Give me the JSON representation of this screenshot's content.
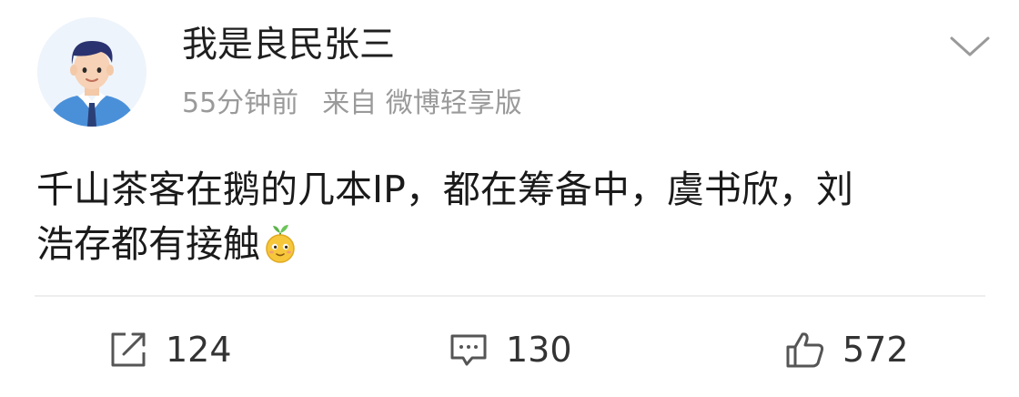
{
  "post": {
    "username": "我是良民张三",
    "time": "55分钟前",
    "source": "来自 微博轻享版",
    "content_line1": "千山茶客在鹅的几本IP，都在筹备中，虞书欣，刘",
    "content_line2": "浩存都有接触",
    "emoji": "sprout-smile-emoji"
  },
  "actions": {
    "repost_count": "124",
    "comment_count": "130",
    "like_count": "572"
  },
  "icons": {
    "menu": "chevron-down-icon",
    "repost": "repost-icon",
    "comment": "comment-icon",
    "like": "thumbs-up-icon"
  },
  "colors": {
    "meta_text": "#9a9a9a",
    "avatar_shirt": "#4a90d9",
    "divider": "#eeeeee"
  }
}
